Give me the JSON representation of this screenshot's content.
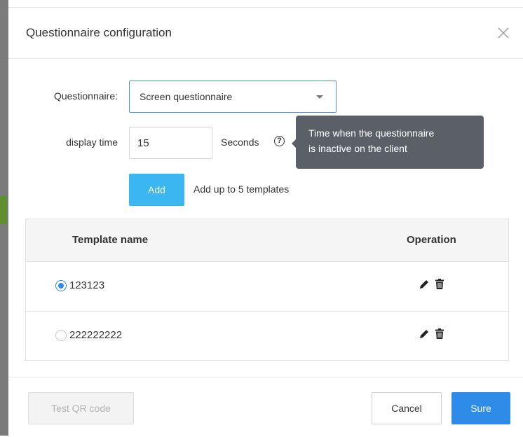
{
  "dialog": {
    "title": "Questionnaire configuration"
  },
  "form": {
    "questionnaire_label": "Questionnaire:",
    "questionnaire_value": "Screen questionnaire",
    "display_time_label": "display time",
    "display_time_value": "15",
    "seconds_label": "Seconds",
    "help_glyph": "?",
    "tooltip_line1": "Time when the questionnaire",
    "tooltip_line2": "is inactive on the client",
    "add_label": "Add",
    "add_hint": "Add up to 5 templates"
  },
  "table": {
    "columns": [
      "Template name",
      "Operation"
    ],
    "rows": [
      {
        "name": "123123",
        "selected": true
      },
      {
        "name": "222222222",
        "selected": false
      }
    ]
  },
  "footer": {
    "test_qr_label": "Test QR code",
    "cancel_label": "Cancel",
    "sure_label": "Sure"
  },
  "colors": {
    "primary": "#2e8be8",
    "add_button": "#3ab6f0",
    "tooltip_bg": "#5b6068"
  },
  "icons": {
    "close": "close-icon",
    "caret": "chevron-down-icon",
    "help": "help-icon",
    "edit": "pencil-icon",
    "delete": "trash-icon"
  }
}
